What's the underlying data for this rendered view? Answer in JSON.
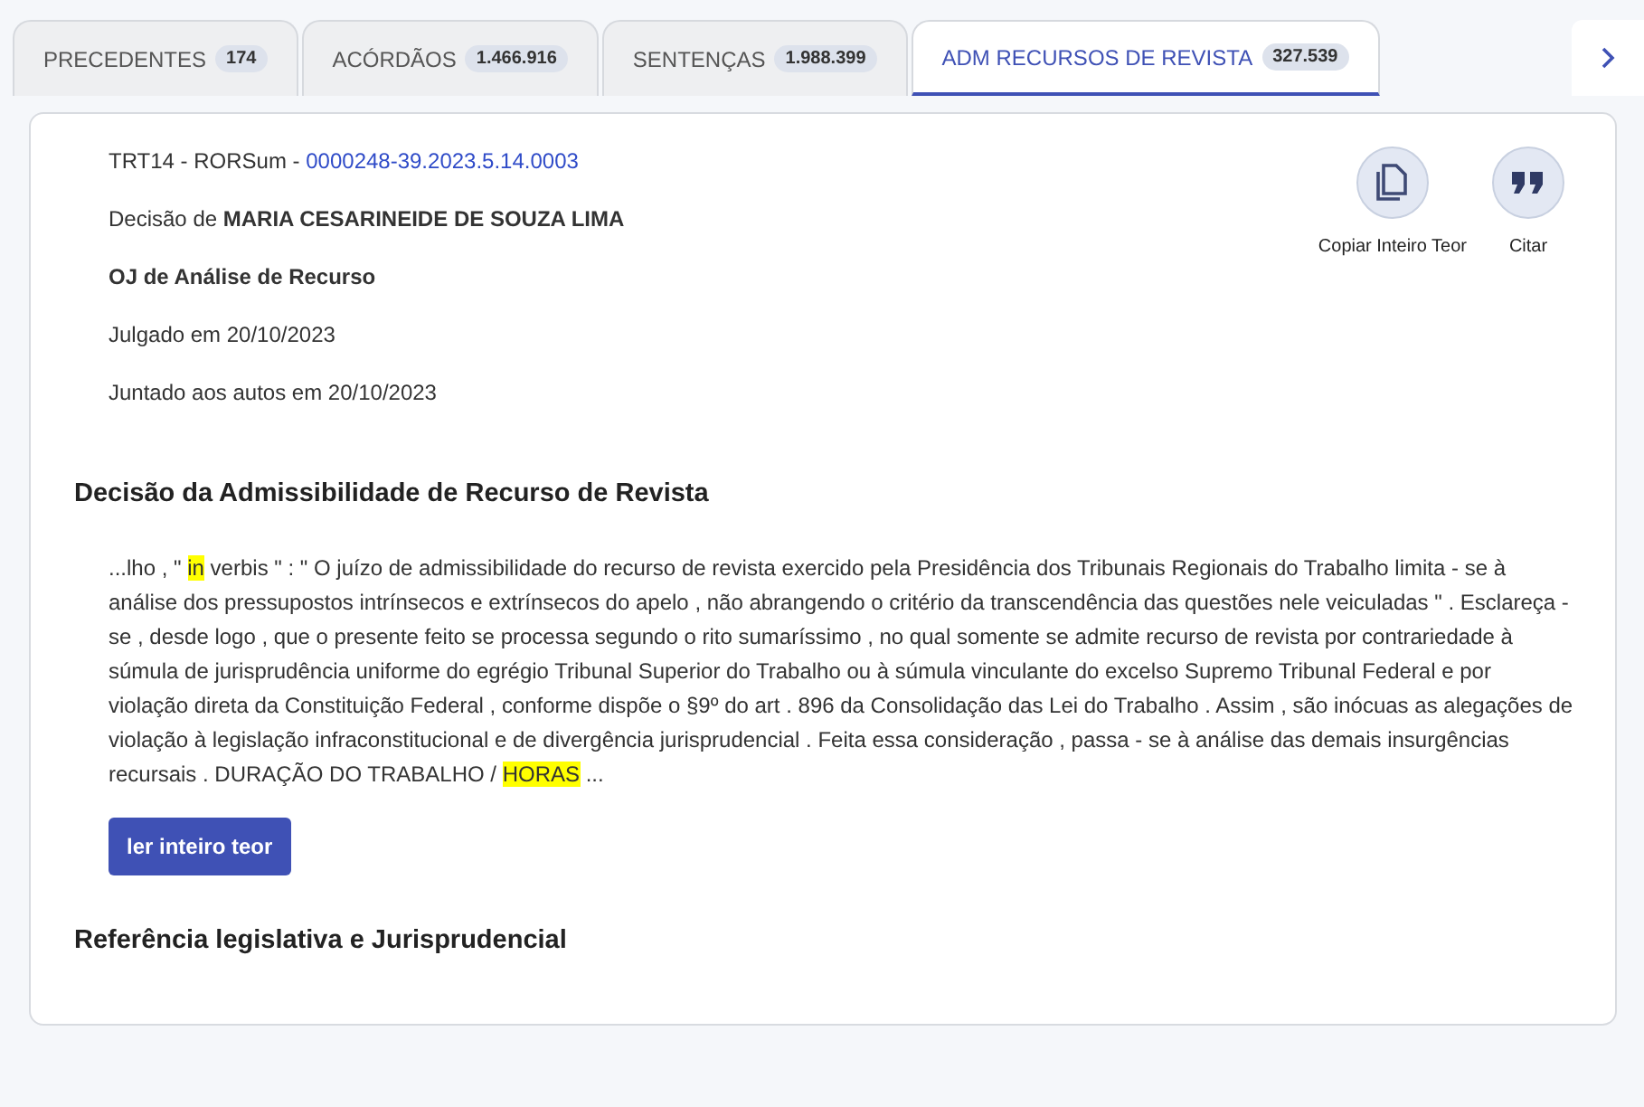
{
  "tabs": [
    {
      "label": "PRECEDENTES",
      "count": "174",
      "selected": false
    },
    {
      "label": "ACÓRDÃOS",
      "count": "1.466.916",
      "selected": false
    },
    {
      "label": "SENTENÇAS",
      "count": "1.988.399",
      "selected": false
    },
    {
      "label": "ADM RECURSOS DE REVISTA",
      "count": "327.539",
      "selected": true
    }
  ],
  "header": {
    "court": "TRT14 - RORSum - ",
    "process_number": "0000248-39.2023.5.14.0003",
    "decision_by": "Decisão de **MARIA CESARINEIDE DE SOUZA LIMA**",
    "body": "OJ de Análise de Recurso",
    "judged": "Julgado em 20/10/2023",
    "attached": "Juntado aos autos em 20/10/2023"
  },
  "actions": [
    {
      "kind": "copy",
      "label": "Copiar Inteiro Teor"
    },
    {
      "kind": "cite",
      "label": "Citar"
    }
  ],
  "section_title": "Decisão da Admissibilidade de Recurso de Revista",
  "excerpt": [
    {
      "text": "...lho , \" ",
      "highlighted": false
    },
    {
      "text": "in",
      "highlighted": true
    },
    {
      "text": " verbis \" : \" O juízo de admissibilidade do recurso de revista exercido pela Presidência dos Tribunais Regionais do Trabalho limita - se à análise dos pressupostos intrínsecos e extrínsecos do apelo , não abrangendo o critério da transcendência das questões nele veiculadas \" . Esclareça - se , desde logo , que o presente feito se processa segundo o rito sumaríssimo , no qual somente se admite recurso de revista por contrariedade à súmula de jurisprudência uniforme do egrégio Tribunal Superior do Trabalho ou à súmula vinculante do excelso Supremo Tribunal Federal e por violação direta da Constituição Federal , conforme dispõe o §9º do art . 896 da Consolidação das Lei do Trabalho . Assim , são inócuas as alegações de violação à legislação infraconstitucional e de divergência jurisprudencial . Feita essa consideração , passa - se à análise das demais insurgências recursais . DURAÇÃO DO TRABALHO / ",
      "highlighted": false
    },
    {
      "text": "HORAS",
      "highlighted": true
    },
    {
      "text": " ...",
      "highlighted": false
    }
  ],
  "read_button": "ler inteiro teor",
  "reference_title": "Referência legislativa e Jurisprudencial"
}
